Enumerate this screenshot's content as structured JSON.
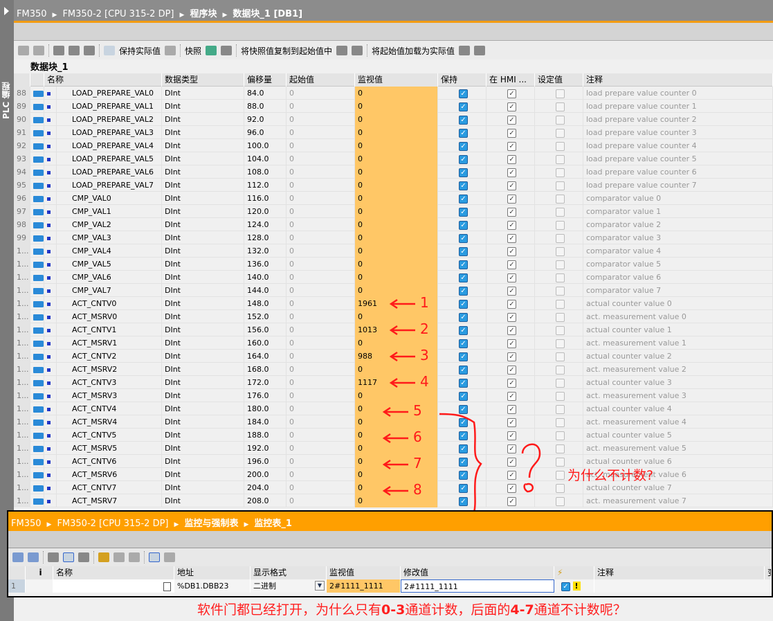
{
  "sidebar": {
    "label": "PLC 编程"
  },
  "breadcrumb": [
    "FM350",
    "FM350-2 [CPU 315-2 DP]",
    "程序块",
    "数据块_1 [DB1]"
  ],
  "toolbar": {
    "keep_actual": "保持实际值",
    "snapshot": "快照",
    "copy_snapshot": "将快照值复制到起始值中",
    "load_start": "将起始值加载为实际值"
  },
  "db_title": "数据块_1",
  "columns": [
    "名称",
    "数据类型",
    "偏移量",
    "起始值",
    "监视值",
    "保持",
    "在 HMI ...",
    "设定值",
    "注释"
  ],
  "rows": [
    {
      "n": "88",
      "name": "LOAD_PREPARE_VAL0",
      "type": "DInt",
      "offset": "84.0",
      "start": "0",
      "monitor": "0",
      "comment": "load prepare value counter 0"
    },
    {
      "n": "89",
      "name": "LOAD_PREPARE_VAL1",
      "type": "DInt",
      "offset": "88.0",
      "start": "0",
      "monitor": "0",
      "comment": "load prepare value counter 1"
    },
    {
      "n": "90",
      "name": "LOAD_PREPARE_VAL2",
      "type": "DInt",
      "offset": "92.0",
      "start": "0",
      "monitor": "0",
      "comment": "load prepare value counter 2"
    },
    {
      "n": "91",
      "name": "LOAD_PREPARE_VAL3",
      "type": "DInt",
      "offset": "96.0",
      "start": "0",
      "monitor": "0",
      "comment": "load prepare value counter 3"
    },
    {
      "n": "92",
      "name": "LOAD_PREPARE_VAL4",
      "type": "DInt",
      "offset": "100.0",
      "start": "0",
      "monitor": "0",
      "comment": "load prepare value counter 4"
    },
    {
      "n": "93",
      "name": "LOAD_PREPARE_VAL5",
      "type": "DInt",
      "offset": "104.0",
      "start": "0",
      "monitor": "0",
      "comment": "load prepare value counter 5"
    },
    {
      "n": "94",
      "name": "LOAD_PREPARE_VAL6",
      "type": "DInt",
      "offset": "108.0",
      "start": "0",
      "monitor": "0",
      "comment": "load prepare value counter 6"
    },
    {
      "n": "95",
      "name": "LOAD_PREPARE_VAL7",
      "type": "DInt",
      "offset": "112.0",
      "start": "0",
      "monitor": "0",
      "comment": "load prepare value counter 7"
    },
    {
      "n": "96",
      "name": "CMP_VAL0",
      "type": "DInt",
      "offset": "116.0",
      "start": "0",
      "monitor": "0",
      "comment": "comparator value 0"
    },
    {
      "n": "97",
      "name": "CMP_VAL1",
      "type": "DInt",
      "offset": "120.0",
      "start": "0",
      "monitor": "0",
      "comment": "comparator value 1"
    },
    {
      "n": "98",
      "name": "CMP_VAL2",
      "type": "DInt",
      "offset": "124.0",
      "start": "0",
      "monitor": "0",
      "comment": "comparator value 2"
    },
    {
      "n": "99",
      "name": "CMP_VAL3",
      "type": "DInt",
      "offset": "128.0",
      "start": "0",
      "monitor": "0",
      "comment": "comparator value 3"
    },
    {
      "n": "1...",
      "name": "CMP_VAL4",
      "type": "DInt",
      "offset": "132.0",
      "start": "0",
      "monitor": "0",
      "comment": "comparator value 4"
    },
    {
      "n": "1...",
      "name": "CMP_VAL5",
      "type": "DInt",
      "offset": "136.0",
      "start": "0",
      "monitor": "0",
      "comment": "comparator value 5"
    },
    {
      "n": "1...",
      "name": "CMP_VAL6",
      "type": "DInt",
      "offset": "140.0",
      "start": "0",
      "monitor": "0",
      "comment": "comparator value 6"
    },
    {
      "n": "1...",
      "name": "CMP_VAL7",
      "type": "DInt",
      "offset": "144.0",
      "start": "0",
      "monitor": "0",
      "comment": "comparator value 7"
    },
    {
      "n": "1...",
      "name": "ACT_CNTV0",
      "type": "DInt",
      "offset": "148.0",
      "start": "0",
      "monitor": "1961",
      "comment": "actual counter value 0"
    },
    {
      "n": "1...",
      "name": "ACT_MSRV0",
      "type": "DInt",
      "offset": "152.0",
      "start": "0",
      "monitor": "0",
      "comment": "act. measurement value 0"
    },
    {
      "n": "1...",
      "name": "ACT_CNTV1",
      "type": "DInt",
      "offset": "156.0",
      "start": "0",
      "monitor": "1013",
      "comment": "actual counter value 1"
    },
    {
      "n": "1...",
      "name": "ACT_MSRV1",
      "type": "DInt",
      "offset": "160.0",
      "start": "0",
      "monitor": "0",
      "comment": "act. measurement value 1"
    },
    {
      "n": "1...",
      "name": "ACT_CNTV2",
      "type": "DInt",
      "offset": "164.0",
      "start": "0",
      "monitor": "988",
      "comment": "actual counter value 2"
    },
    {
      "n": "1...",
      "name": "ACT_MSRV2",
      "type": "DInt",
      "offset": "168.0",
      "start": "0",
      "monitor": "0",
      "comment": "act. measurement value 2"
    },
    {
      "n": "1...",
      "name": "ACT_CNTV3",
      "type": "DInt",
      "offset": "172.0",
      "start": "0",
      "monitor": "1117",
      "comment": "actual counter value 3"
    },
    {
      "n": "1...",
      "name": "ACT_MSRV3",
      "type": "DInt",
      "offset": "176.0",
      "start": "0",
      "monitor": "0",
      "comment": "act. measurement value 3"
    },
    {
      "n": "1...",
      "name": "ACT_CNTV4",
      "type": "DInt",
      "offset": "180.0",
      "start": "0",
      "monitor": "0",
      "comment": "actual counter value 4"
    },
    {
      "n": "1...",
      "name": "ACT_MSRV4",
      "type": "DInt",
      "offset": "184.0",
      "start": "0",
      "monitor": "0",
      "comment": "act. measurement value 4"
    },
    {
      "n": "1...",
      "name": "ACT_CNTV5",
      "type": "DInt",
      "offset": "188.0",
      "start": "0",
      "monitor": "0",
      "comment": "actual counter value 5"
    },
    {
      "n": "1...",
      "name": "ACT_MSRV5",
      "type": "DInt",
      "offset": "192.0",
      "start": "0",
      "monitor": "0",
      "comment": "act. measurement value 5"
    },
    {
      "n": "1...",
      "name": "ACT_CNTV6",
      "type": "DInt",
      "offset": "196.0",
      "start": "0",
      "monitor": "0",
      "comment": "actual counter value 6"
    },
    {
      "n": "1...",
      "name": "ACT_MSRV6",
      "type": "DInt",
      "offset": "200.0",
      "start": "0",
      "monitor": "0",
      "comment": "act. measurement value 6"
    },
    {
      "n": "1...",
      "name": "ACT_CNTV7",
      "type": "DInt",
      "offset": "204.0",
      "start": "0",
      "monitor": "0",
      "comment": "actual counter value 7"
    },
    {
      "n": "1...",
      "name": "ACT_MSRV7",
      "type": "DInt",
      "offset": "208.0",
      "start": "0",
      "monitor": "0",
      "comment": "act. measurement value 7"
    }
  ],
  "watch": {
    "breadcrumb": [
      "FM350",
      "FM350-2 [CPU 315-2 DP]",
      "监控与强制表",
      "监控表_1"
    ],
    "columns": [
      "i",
      "名称",
      "地址",
      "显示格式",
      "监视值",
      "修改值",
      "",
      "注释",
      "变"
    ],
    "row": {
      "n": "1",
      "name": "",
      "address": "%DB1.DBB23",
      "format": "二进制",
      "monitor": "2#1111_1111",
      "modify": "2#1111_1111"
    }
  },
  "annotations": {
    "marks": [
      "1",
      "2",
      "3",
      "4",
      "5",
      "6",
      "7",
      "8"
    ],
    "side_question": "为什么不计数?",
    "question_prefix": "软件门都已经打开，为什么只有",
    "range1": "0-3",
    "mid": "通道计数，后面的",
    "range2": "4-7",
    "suffix": "通道不计数呢？"
  },
  "colors": {
    "accent": "#ff9f00",
    "monitor_cell": "#ffc766",
    "annotation": "#ff1a1a"
  }
}
